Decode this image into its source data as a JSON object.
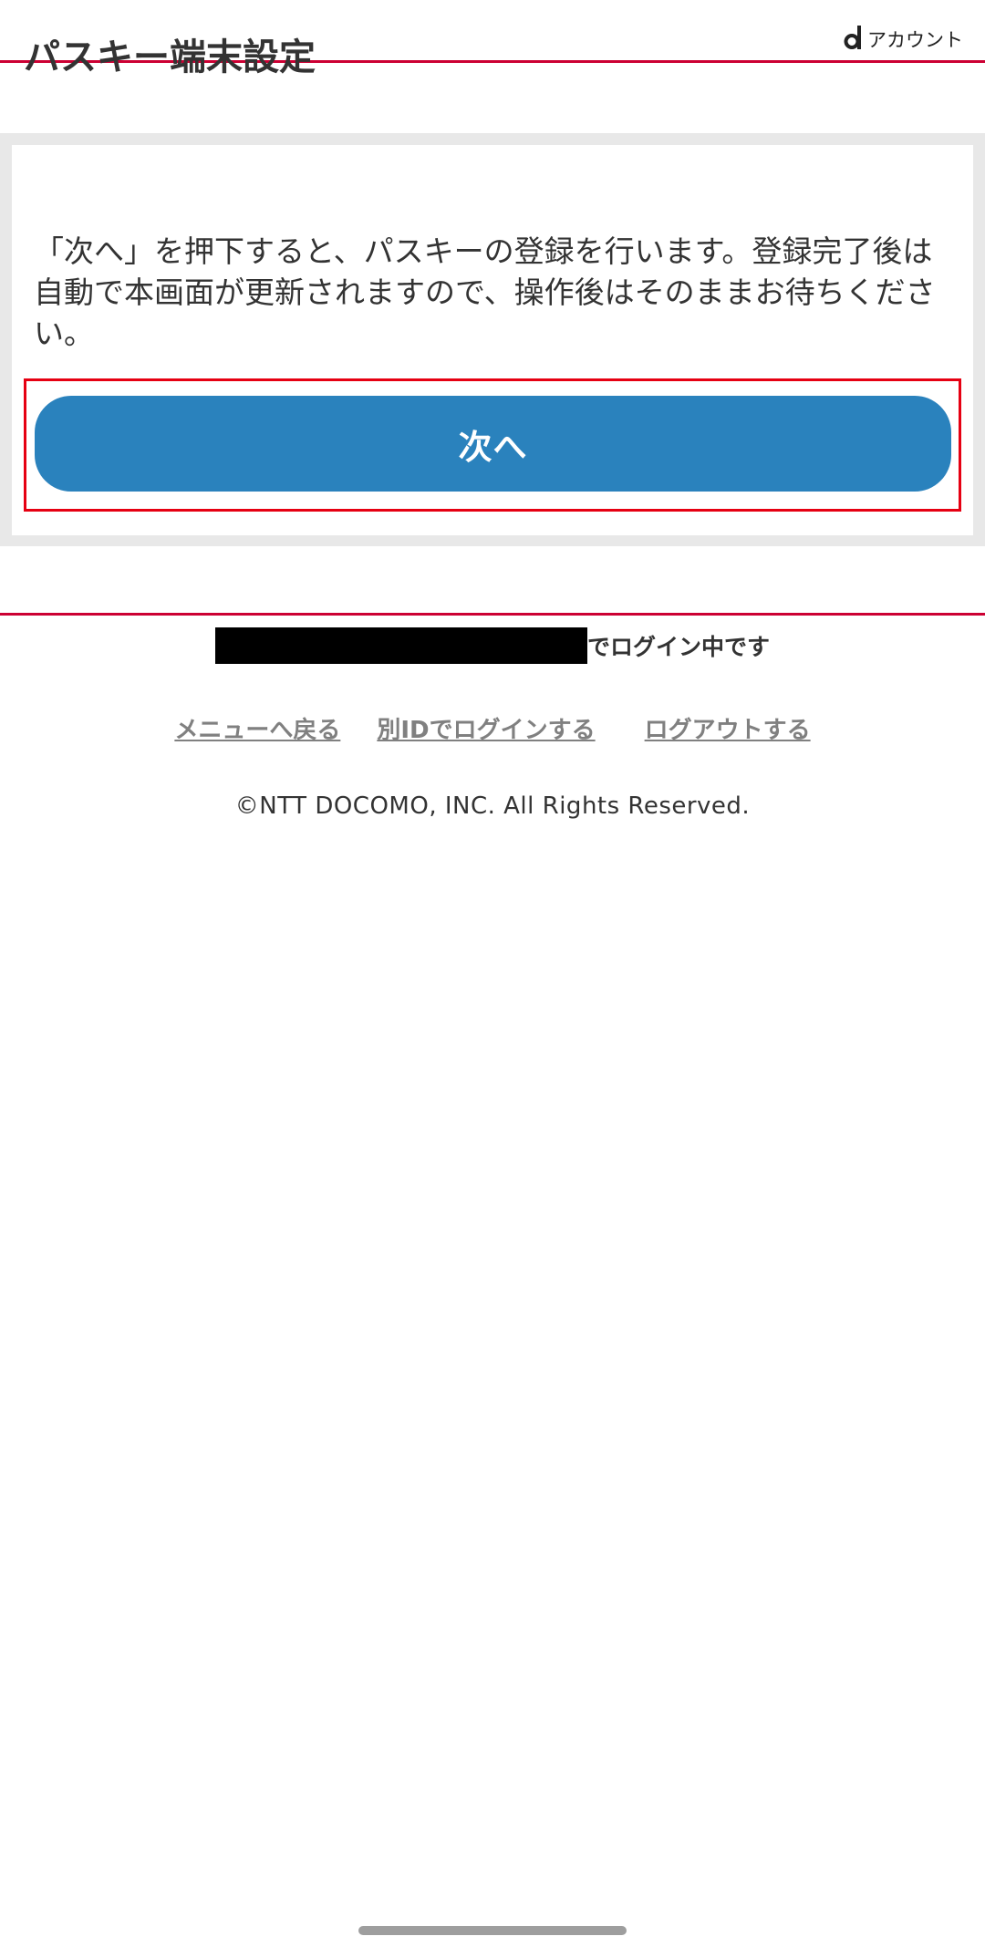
{
  "header": {
    "title": "パスキー端末設定",
    "brand_text": "アカウント"
  },
  "content": {
    "instruction": "「次へ」を押下すると、パスキーの登録を行います。登録完了後は自動で本画面が更新されますので、操作後はそのままお待ちください。",
    "next_button_label": "次へ"
  },
  "footer": {
    "login_status_suffix": "でログイン中です",
    "links": {
      "menu": "メニューへ戻る",
      "other_id": "別IDでログインする",
      "logout": "ログアウトする"
    },
    "copyright": "©NTT DOCOMO, INC. All Rights Reserved."
  },
  "colors": {
    "accent_red": "#cc0033",
    "button_blue": "#2a82bd",
    "highlight_frame": "#e60012"
  }
}
